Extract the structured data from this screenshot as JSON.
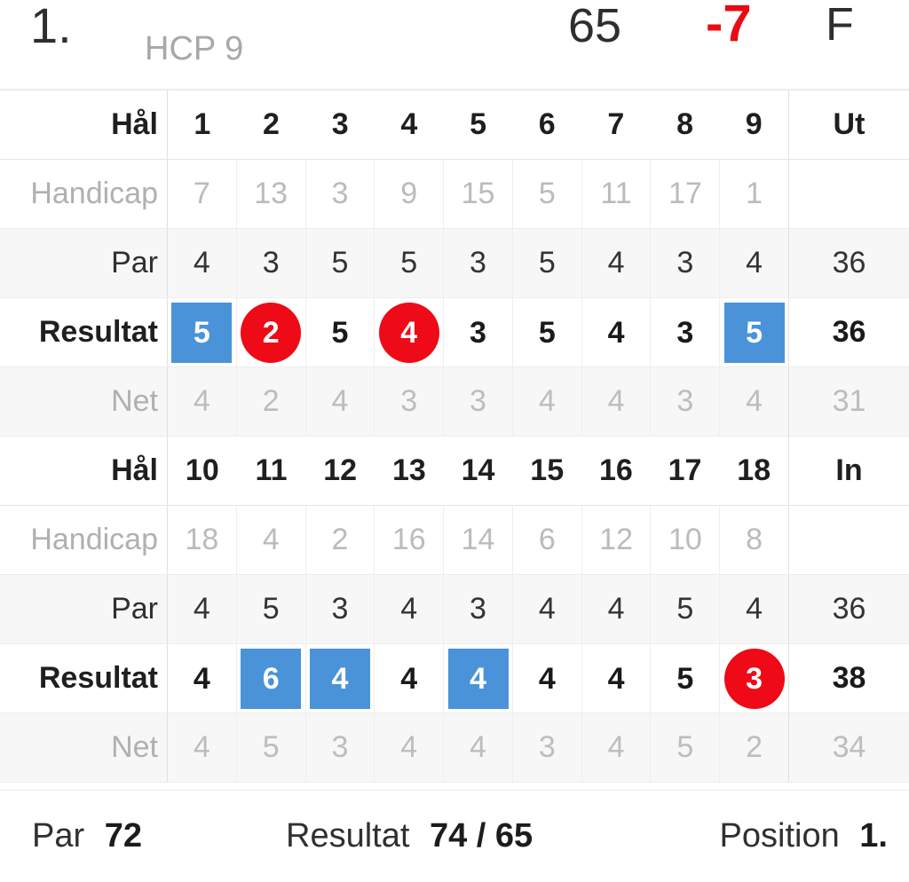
{
  "summary": {
    "position": "1.",
    "handicap_label": "HCP 9",
    "gross": "65",
    "to_par": "-7",
    "thru": "F",
    "to_par_color": "#ea0a14"
  },
  "colors": {
    "bogey_blue": "#4a93d9",
    "birdie_red": "#ee0a17",
    "muted_text": "#bdbdbd",
    "row_shade": "#f7f7f7"
  },
  "row_labels": {
    "hole": "Hål",
    "handicap": "Handicap",
    "par": "Par",
    "result": "Resultat",
    "net": "Net"
  },
  "front": {
    "total_header": "Ut",
    "holes": [
      "1",
      "2",
      "3",
      "4",
      "5",
      "6",
      "7",
      "8",
      "9"
    ],
    "handicap": [
      "7",
      "13",
      "3",
      "9",
      "15",
      "5",
      "11",
      "17",
      "1"
    ],
    "handicap_total": "",
    "par": [
      "4",
      "3",
      "5",
      "5",
      "3",
      "5",
      "4",
      "3",
      "4"
    ],
    "par_total": "36",
    "result": [
      "5",
      "2",
      "5",
      "4",
      "3",
      "5",
      "4",
      "3",
      "5"
    ],
    "result_marks": [
      "bogey",
      "birdie",
      "plain",
      "birdie",
      "plain",
      "plain",
      "plain",
      "plain",
      "bogey"
    ],
    "result_total": "36",
    "net": [
      "4",
      "2",
      "4",
      "3",
      "3",
      "4",
      "4",
      "3",
      "4"
    ],
    "net_total": "31"
  },
  "back": {
    "total_header": "In",
    "holes": [
      "10",
      "11",
      "12",
      "13",
      "14",
      "15",
      "16",
      "17",
      "18"
    ],
    "handicap": [
      "18",
      "4",
      "2",
      "16",
      "14",
      "6",
      "12",
      "10",
      "8"
    ],
    "handicap_total": "",
    "par": [
      "4",
      "5",
      "3",
      "4",
      "3",
      "4",
      "4",
      "5",
      "4"
    ],
    "par_total": "36",
    "result": [
      "4",
      "6",
      "4",
      "4",
      "4",
      "4",
      "4",
      "5",
      "3"
    ],
    "result_marks": [
      "plain",
      "bogey",
      "bogey",
      "plain",
      "bogey",
      "plain",
      "plain",
      "plain",
      "birdie"
    ],
    "result_total": "38",
    "net": [
      "4",
      "5",
      "3",
      "4",
      "4",
      "3",
      "4",
      "5",
      "2"
    ],
    "net_total": "34"
  },
  "footer": {
    "par_key": "Par",
    "par_value": "72",
    "result_key": "Resultat",
    "result_value": "74 / 65",
    "position_key": "Position",
    "position_value": "1."
  }
}
